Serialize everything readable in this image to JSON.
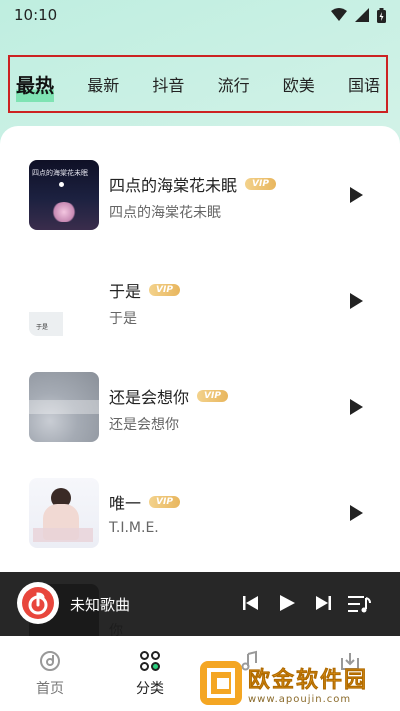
{
  "status_bar": {
    "time": "10:10"
  },
  "tabs": [
    {
      "label": "最热",
      "active": true
    },
    {
      "label": "最新"
    },
    {
      "label": "抖音"
    },
    {
      "label": "流行"
    },
    {
      "label": "欧美"
    },
    {
      "label": "国语"
    }
  ],
  "songs": [
    {
      "title": "四点的海棠花未眠",
      "subtitle": "四点的海棠花未眠",
      "vip": "VIP",
      "cover_text": "四点的海棠花未眠"
    },
    {
      "title": "于是",
      "subtitle": "于是",
      "vip": "VIP",
      "cover_text": "于是"
    },
    {
      "title": "还是会想你",
      "subtitle": "还是会想你",
      "vip": "VIP",
      "cover_text": ""
    },
    {
      "title": "唯一",
      "subtitle": "T.I.M.E.",
      "vip": "VIP",
      "cover_text": ""
    },
    {
      "subtitle": "你"
    }
  ],
  "mini_player": {
    "title": "未知歌曲"
  },
  "bottom_nav": [
    {
      "label": "首页",
      "icon": "home-disc-icon"
    },
    {
      "label": "分类",
      "icon": "category-grid-icon",
      "active": true
    },
    {
      "label": "",
      "icon": "music-note-icon"
    },
    {
      "label": "",
      "icon": "download-icon"
    }
  ],
  "watermark": {
    "text": "欧金软件园",
    "url": "www.apoujin.com"
  },
  "colors": {
    "accent": "#7fe3b3",
    "vip": "#e8b65e",
    "player_bg": "#191919",
    "tab_border": "#cc2222"
  }
}
